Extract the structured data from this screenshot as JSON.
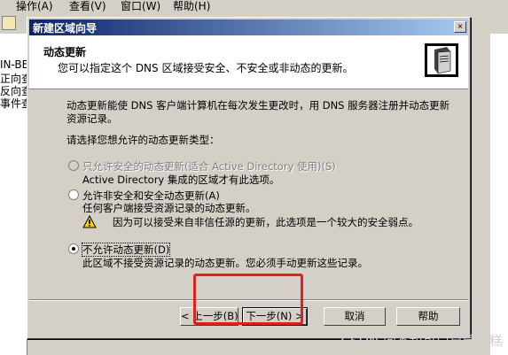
{
  "menubar": {
    "items": [
      "操作(A)",
      "查看(V)",
      "窗口(W)",
      "帮助(H)"
    ]
  },
  "background_panel": {
    "lines": [
      "IN-BE",
      "正向查",
      "反向查",
      "事件查"
    ]
  },
  "dialog": {
    "title": "新建区域向导",
    "close_label": "×",
    "header_title": "动态更新",
    "header_subtitle": "您可以指定这个 DNS 区域接受安全、不安全或非动态的更新。",
    "description": "动态更新能使 DNS 客户端计算机在每次发生更改时，用 DNS 服务器注册并动态更新资源记录。",
    "prompt": "请选择您想允许的动态更新类型：",
    "options": [
      {
        "label": "只允许安全的动态更新(适合 Active Directory 使用)(S)",
        "detail": "Active Directory 集成的区域才有此选项。",
        "checked": false,
        "disabled": true
      },
      {
        "label": "允许非安全和安全动态更新(A)",
        "detail": "任何客户端接受资源记录的动态更新。",
        "checked": false,
        "disabled": false
      },
      {
        "label": "不允许动态更新(D)",
        "detail": "此区域不接受资源记录的动态更新。您必须手动更新这些记录。",
        "checked": true,
        "disabled": false
      }
    ],
    "warning": "因为可以接受来自非信任源的更新，此选项是一个较大的安全弱点。",
    "buttons": {
      "back": "< 上一步(B)",
      "next": "下一步(N) >",
      "cancel": "取消",
      "help": "帮助"
    }
  },
  "watermark": "CSDN @香甜可口草莓蛋糕",
  "colors": {
    "title_gradient_start": "#0a246a",
    "title_gradient_end": "#a6caf0",
    "highlight_box": "#e02020",
    "warning_yellow": "#f5d000"
  }
}
